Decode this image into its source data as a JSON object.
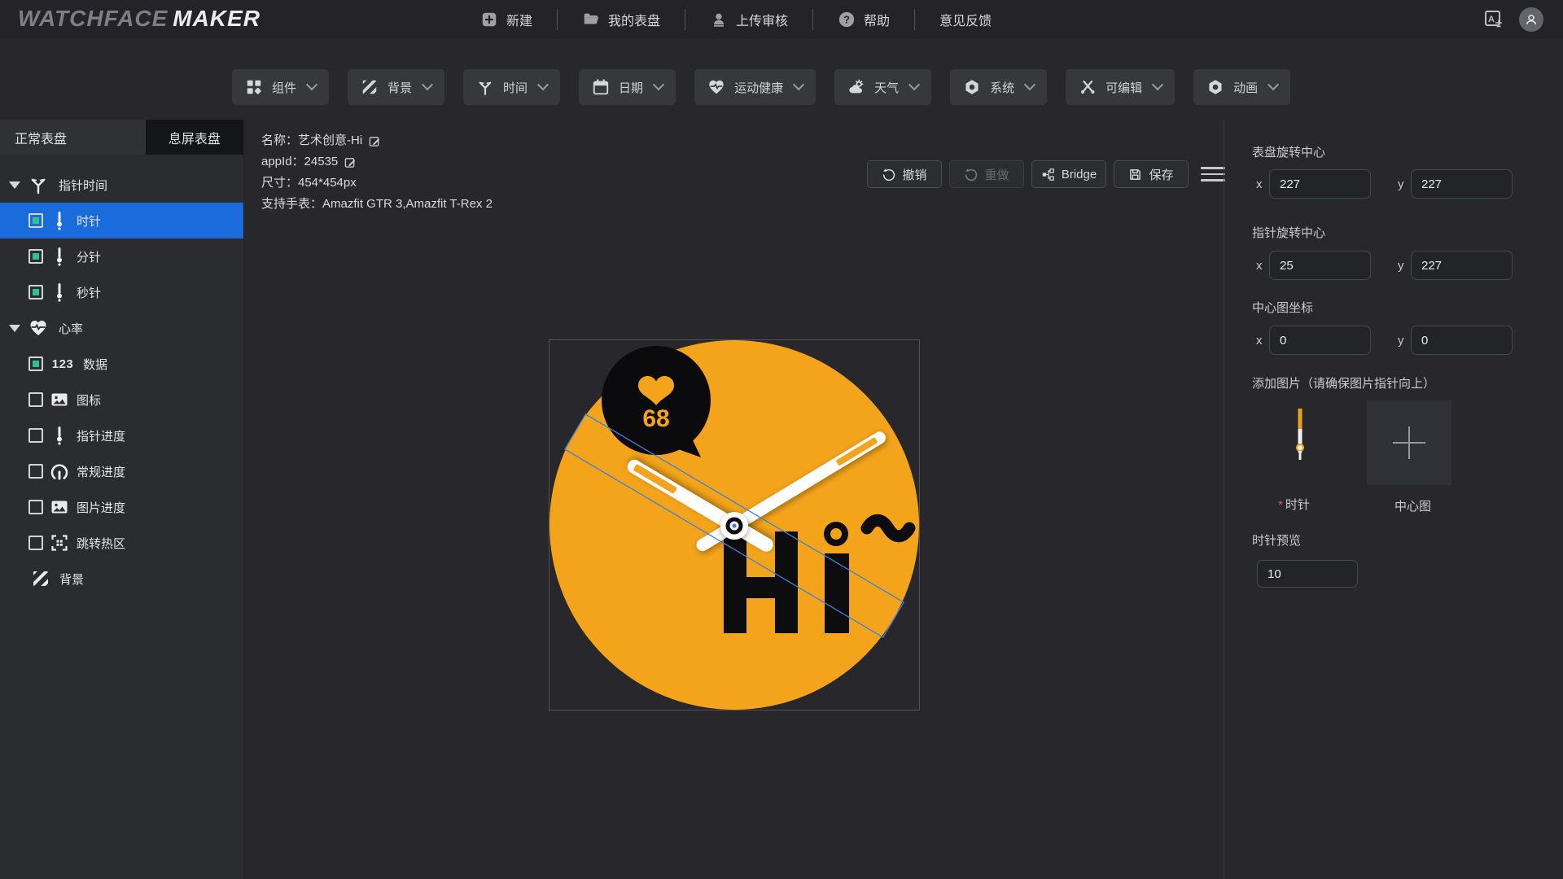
{
  "topbar": {
    "logo_primary": "WATCHFACE",
    "logo_secondary": "MAKER",
    "nav_new": "新建",
    "nav_my_watchfaces": "我的表盘",
    "nav_upload_review": "上传审核",
    "nav_help": "帮助",
    "nav_feedback": "意见反馈"
  },
  "toolbar": {
    "components": "组件",
    "background": "背景",
    "time": "时间",
    "date": "日期",
    "sport_health": "运动健康",
    "weather": "天气",
    "system": "系统",
    "editable": "可编辑",
    "animation": "动画"
  },
  "sidebar": {
    "tab_normal": "正常表盘",
    "tab_aod": "息屏表盘",
    "group_pointer_time": "指针时间",
    "layer_hour": "时针",
    "layer_minute": "分针",
    "layer_second": "秒针",
    "group_heart_rate": "心率",
    "layer_data": "数据",
    "data_icon_text": "123",
    "layer_icon": "图标",
    "layer_pointer_progress": "指针进度",
    "layer_normal_progress": "常规进度",
    "layer_image_progress": "图片进度",
    "layer_jump_hotspot": "跳转热区",
    "layer_background": "背景"
  },
  "canvas": {
    "info_name": "名称：艺术创意-Hi",
    "info_app_id": "appId：24535",
    "info_size": "尺寸：454*454px",
    "info_watches": "支持手表：Amazfit GTR 3,Amazfit T-Rex 2",
    "btn_undo": "撤销",
    "btn_redo": "重做",
    "btn_bridge": "Bridge",
    "btn_save": "保存",
    "watch": {
      "heart_rate": "68",
      "greeting": "Hi~",
      "face_color": "#F3A41B",
      "bubble_color": "#0b0b0d",
      "selection_color": "#3e82d6"
    }
  },
  "right_panel": {
    "axis_x": "x",
    "axis_y": "y",
    "dial_center_label": "表盘旋转中心",
    "dial_center_x": "227",
    "dial_center_y": "227",
    "hand_center_label": "指针旋转中心",
    "hand_center_x": "25",
    "hand_center_y": "227",
    "center_image_label": "中心图坐标",
    "center_image_x": "0",
    "center_image_y": "0",
    "add_image_note": "添加图片（请确保图片指针向上）",
    "required_mark": "*",
    "hand_image_label": "时针",
    "center_image_slot_label": "中心图",
    "hand_preview_label": "时针预览",
    "hand_preview_value": "10"
  }
}
